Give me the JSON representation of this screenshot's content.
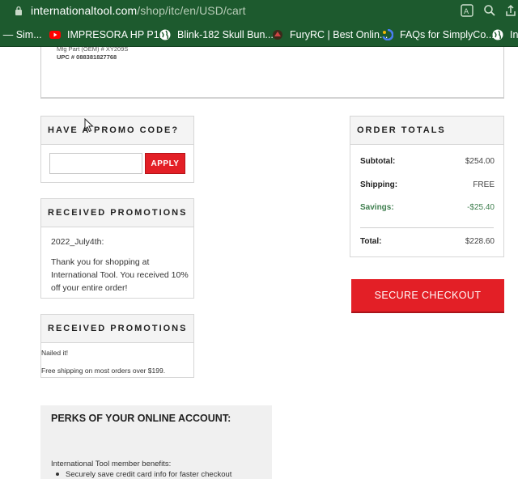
{
  "browser": {
    "url_host": "internationaltool.com",
    "url_path": "/shop/itc/en/USD/cart",
    "action_icons": [
      "translate-icon",
      "zoom-icon",
      "share-icon"
    ]
  },
  "bookmarks": [
    {
      "label": "s — Sim...",
      "icon": "none"
    },
    {
      "label": "IMPRESORA HP P1...",
      "icon": "youtube-icon"
    },
    {
      "label": "Blink-182 Skull Bun...",
      "icon": "globe-icon"
    },
    {
      "label": "FuryRC | Best Onlin...",
      "icon": "furyrc-icon"
    },
    {
      "label": "FAQs for SimplyCo...",
      "icon": "simply-icon"
    },
    {
      "label": "Int",
      "icon": "globe-icon"
    }
  ],
  "product": {
    "mfg_part_line": "Mfg Part (OEM) # XY209S",
    "upc_line": "UPC #  088381827768"
  },
  "promo": {
    "title": "HAVE A PROMO CODE?",
    "input_value": "",
    "apply_label": "APPLY"
  },
  "received_promotions": [
    {
      "title": "RECEIVED PROMOTIONS",
      "name": "2022_July4th:",
      "description": "Thank you for shopping at International Tool. You received 10% off your entire order!"
    },
    {
      "title": "RECEIVED PROMOTIONS",
      "line1": "Nailed it!",
      "line2": "Free shipping on most orders over $199."
    }
  ],
  "perks": {
    "title": "PERKS OF YOUR ONLINE ACCOUNT:",
    "intro": "International Tool member benefits:",
    "bullets": [
      "Securely save credit card info for faster checkout"
    ]
  },
  "order_totals": {
    "title": "ORDER TOTALS",
    "subtotal_label": "Subtotal:",
    "subtotal_value": "$254.00",
    "shipping_label": "Shipping:",
    "shipping_value": "FREE",
    "savings_label": "Savings:",
    "savings_value": "-$25.40",
    "total_label": "Total:",
    "total_value": "$228.60"
  },
  "checkout": {
    "label": "SECURE CHECKOUT"
  },
  "colors": {
    "chrome_green": "#1d5a2e",
    "accent_red": "#e31f26",
    "savings_green": "#3f7f4f",
    "panel_header_bg": "#f4f4f4"
  }
}
